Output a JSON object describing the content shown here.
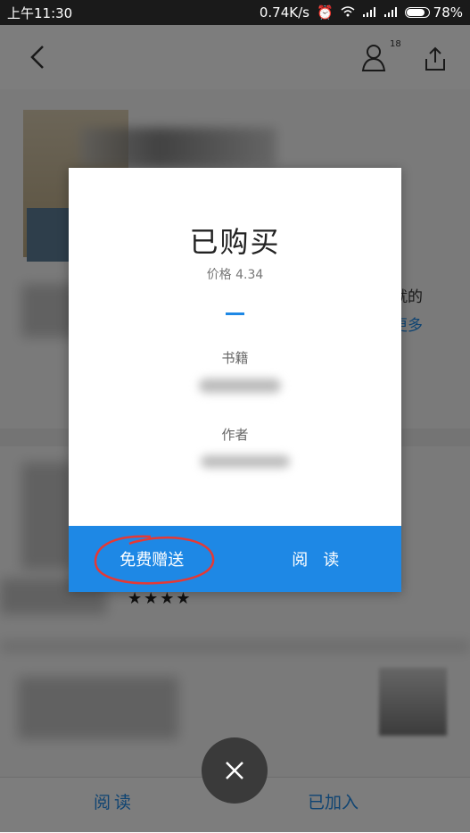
{
  "status_bar": {
    "time": "上午11:30",
    "net_speed": "0.74K/s",
    "battery": "78%"
  },
  "header": {
    "user_count": "18"
  },
  "background": {
    "desc_tail": "就的",
    "more_link": "更多",
    "rating_stars": "★★★★"
  },
  "dialog": {
    "title": "已购买",
    "price": "价格 4.34",
    "book_label": "书籍",
    "author_label": "作者",
    "gift_button": "免费赠送",
    "read_button": "阅 读"
  },
  "bottom_bar": {
    "read": "阅读",
    "added": "已加入"
  },
  "colors": {
    "accent": "#1e88e5",
    "annotation": "#e53935"
  },
  "icons": [
    "back-icon",
    "user-icon",
    "share-icon",
    "close-icon",
    "alarm-icon",
    "wifi-icon",
    "signal-icon",
    "battery-icon"
  ]
}
